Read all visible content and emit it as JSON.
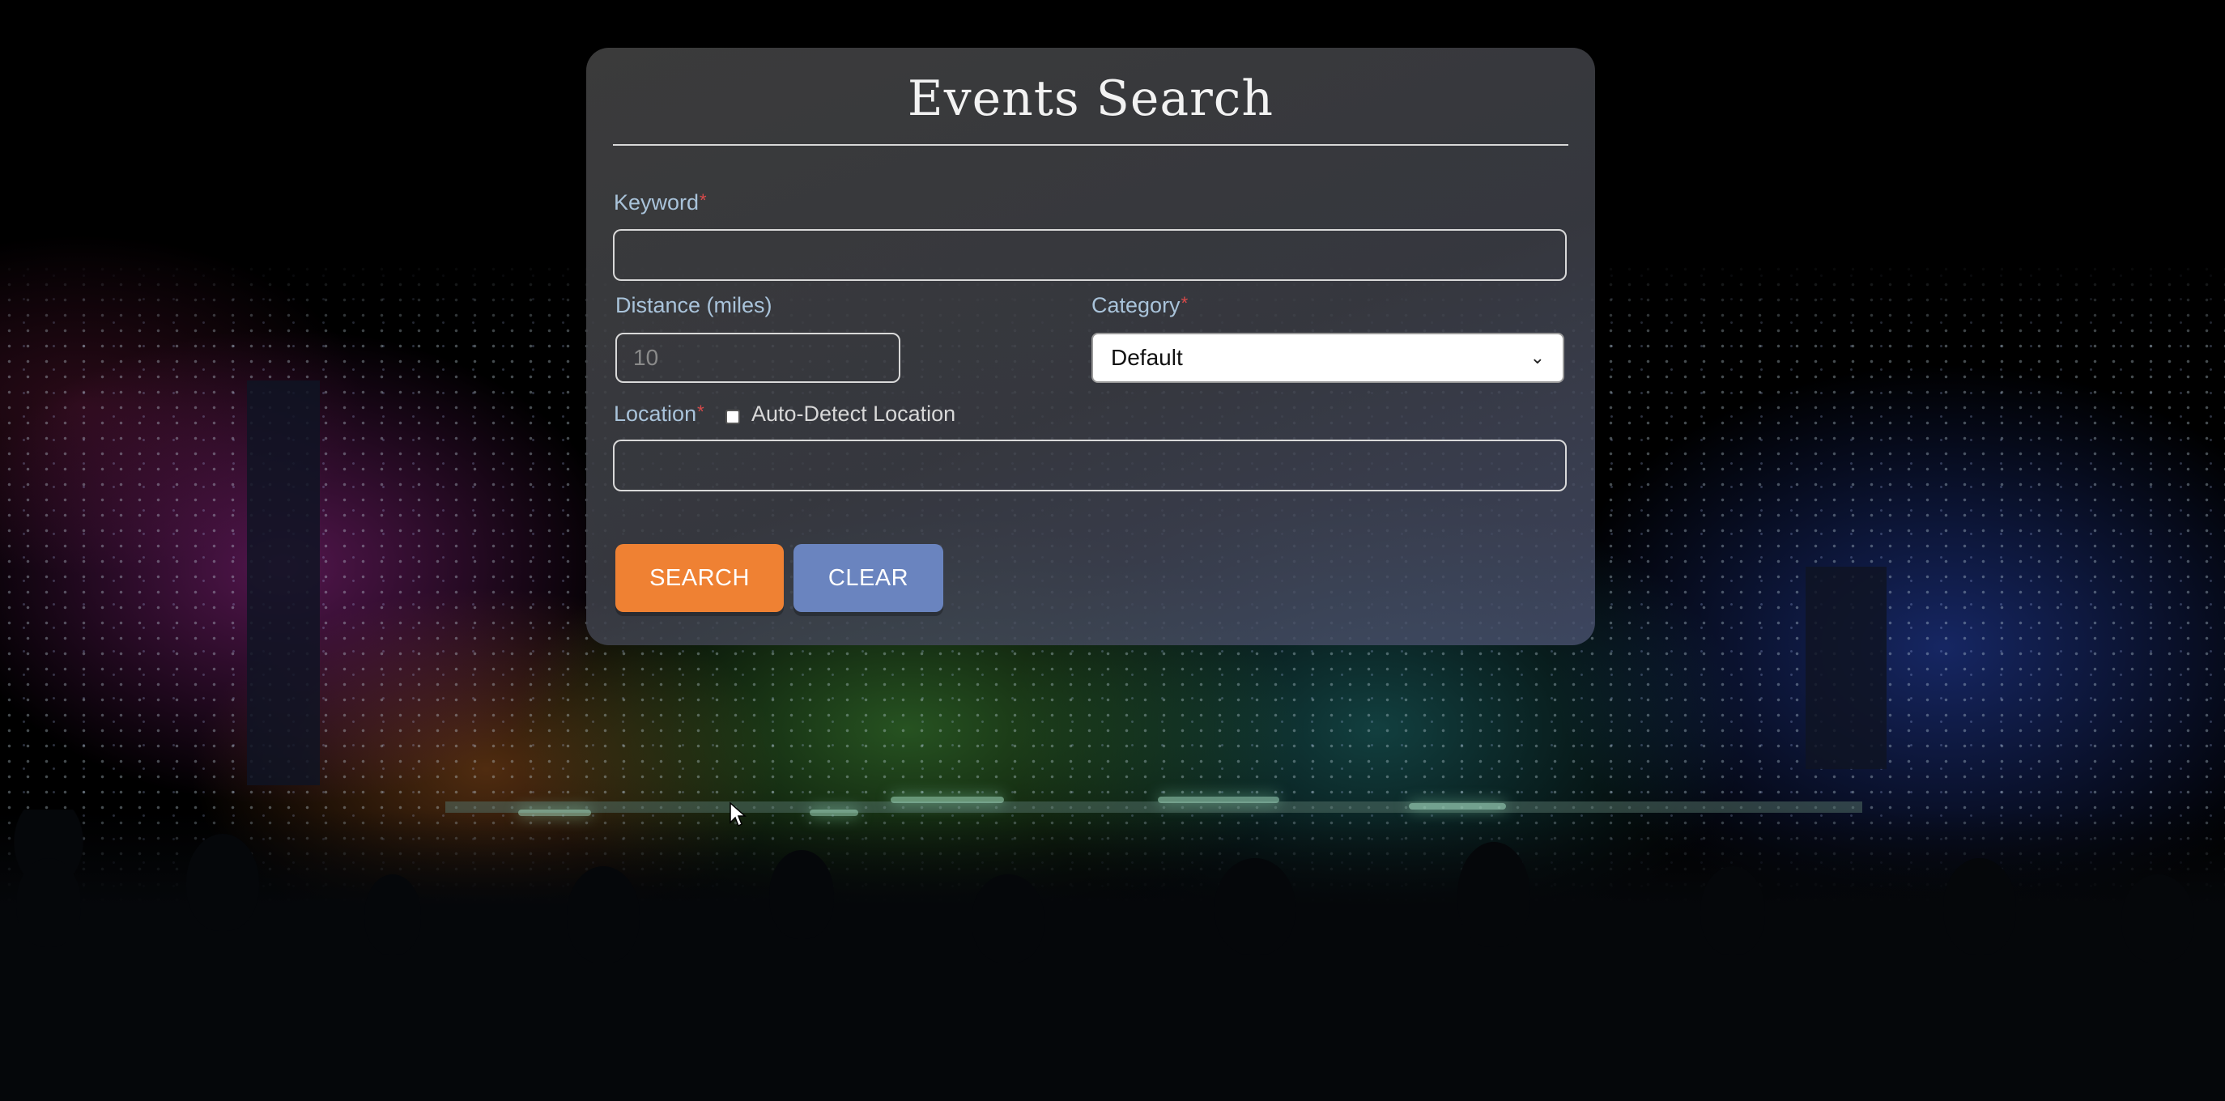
{
  "form": {
    "title": "Events Search",
    "keyword": {
      "label": "Keyword",
      "required_mark": "*",
      "value": ""
    },
    "distance": {
      "label": "Distance (miles)",
      "placeholder": "10",
      "value": ""
    },
    "category": {
      "label": "Category",
      "required_mark": "*",
      "selected": "Default"
    },
    "location": {
      "label": "Location",
      "required_mark": "*",
      "value": "",
      "auto_detect_label": "Auto-Detect Location",
      "auto_detect_checked": false
    },
    "buttons": {
      "search_label": "SEARCH",
      "clear_label": "CLEAR"
    }
  },
  "colors": {
    "search_button": "#ef8133",
    "clear_button": "#6a84bf",
    "label": "#a9c3da",
    "required": "#d94a4a"
  },
  "icons": {
    "select_arrow": "chevron-down-icon",
    "pointer": "mouse-cursor-icon"
  }
}
